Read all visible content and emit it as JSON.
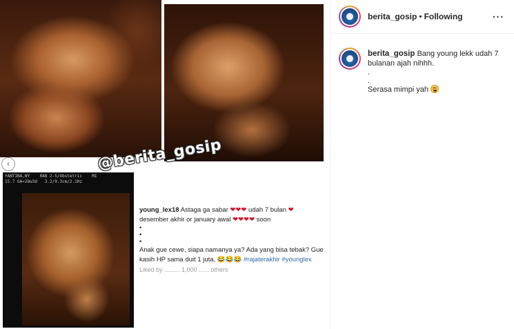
{
  "media": {
    "watermark": "@berita_gosip",
    "ultrasound_header": "YANTINA,NY    RAB 2-5/Obstetric    MI\n15.7 GA=28w3d   3.2/9.3cm/2.1Hz",
    "prev_arrow": "‹",
    "comment_card": {
      "username": "young_lex18",
      "line1": "Astaga ga sabar",
      "hearts1": "❤❤❤",
      "line1b": "udah 7 bulan",
      "heart1c": "❤",
      "line2": "desember akhir or january awal",
      "hearts2": "❤❤❤❤",
      "line2b": "soon",
      "dot": "•",
      "line3": "Anak gue cewe, siapa namanya ya? Ada yang bisa tebak? Gue",
      "line4": "kasih HP sama duit 1 juta,",
      "laugh": "😂😂😂",
      "tag1": "#rajaterakhir",
      "tag2": "#younglex",
      "faded": "Liked by ......... 1,000 ...... others"
    }
  },
  "header": {
    "username": "berita_gosip",
    "separator": "•",
    "follow_label": "Following",
    "more_label": "···"
  },
  "caption": {
    "username": "berita_gosip",
    "text1": "Bang young lekk udah 7 bulanan ajah nihhh.",
    "dot": ".",
    "text2": "Serasa mimpi yah"
  }
}
